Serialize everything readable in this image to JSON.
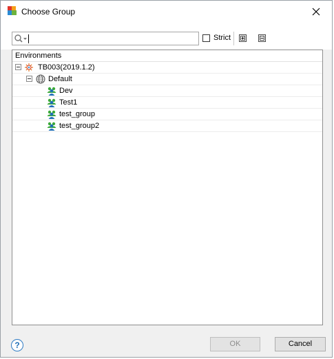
{
  "window": {
    "title": "Choose Group"
  },
  "toolbar": {
    "search_value": "",
    "strict_label": "Strict",
    "strict_checked": false
  },
  "tree": {
    "header": "Environments",
    "environment": {
      "label": "TB003(2019.1.2)"
    },
    "domain": {
      "label": "Default"
    },
    "groups": [
      "Dev",
      "Test1",
      "test_group",
      "test_group2"
    ]
  },
  "footer": {
    "help_label": "?",
    "ok_label": "OK",
    "cancel_label": "Cancel"
  }
}
